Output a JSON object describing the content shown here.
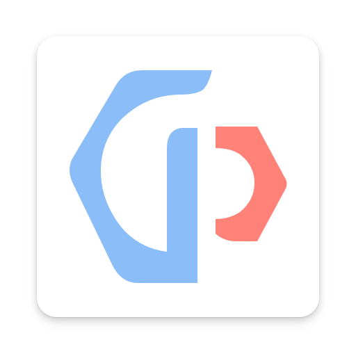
{
  "app_icon": {
    "icon_name": "app-logo-icon",
    "colors": {
      "tile_background": "#ffffff",
      "primary_blue": "#8bbdf9",
      "accent_coral": "#ff8279"
    }
  }
}
